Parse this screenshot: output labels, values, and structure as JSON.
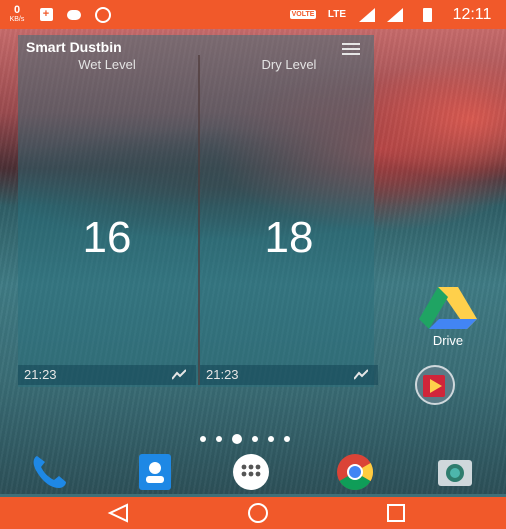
{
  "status_bar": {
    "kbps_value": "0",
    "kbps_unit": "KB/s",
    "volte": "VOLTE",
    "lte": "LTE",
    "time": "12:11",
    "icons": [
      "data-speed-icon",
      "box-notification-icon",
      "hd-icon",
      "whatsapp-icon",
      "signal-icon",
      "signal-icon",
      "battery-icon"
    ]
  },
  "widget": {
    "title": "Smart Dustbin",
    "columns": [
      {
        "label": "Wet Level",
        "value": "16",
        "time": "21:23"
      },
      {
        "label": "Dry Level",
        "value": "18",
        "time": "21:23"
      }
    ]
  },
  "desktop": {
    "drive_label": "Drive",
    "page_indicator": {
      "pages": 6,
      "current": 3
    }
  },
  "dock": [
    "phone-icon",
    "contacts-icon",
    "app-drawer-icon",
    "chrome-icon",
    "camera-icon"
  ],
  "navigation": [
    "back-icon",
    "home-icon",
    "recents-icon"
  ],
  "colors": {
    "status_bar": "#f1592a",
    "nav_bar": "#f1592a",
    "drive_green": "#1fa463",
    "drive_yellow": "#ffd04b",
    "drive_blue": "#4285f4"
  }
}
